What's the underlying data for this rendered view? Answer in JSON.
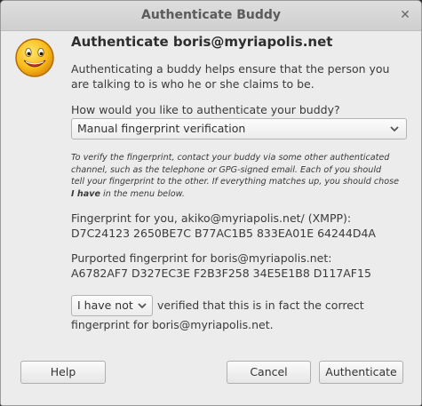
{
  "window": {
    "title": "Authenticate Buddy",
    "close_label": "✕"
  },
  "dialog": {
    "icon": "smiley-icon",
    "heading": "Authenticate boris@myriapolis.net",
    "intro_line1": "Authenticating a buddy helps ensure that the person you",
    "intro_line2": "are talking to is who he or she claims to be.",
    "question": "How would you like to authenticate your buddy?",
    "method_selected": "Manual fingerprint verification",
    "help_line1": "To verify the fingerprint, contact your buddy via some other authenticated",
    "help_line2": "channel, such as the telephone or GPG-signed email.  Each of you should",
    "help_line3_pre": "tell your fingerprint to the other. If everything matches up, you should chose",
    "help_line4_bold": "I have",
    "help_line4_post": " in the menu below.",
    "fp_you_label": "Fingerprint for you, akiko@myriapolis.net/ (XMPP):",
    "fp_you_value": "D7C24123 2650BE7C B77AC1B5 833EA01E 64244D4A",
    "fp_buddy_label": "Purported fingerprint for boris@myriapolis.net:",
    "fp_buddy_value": "A6782AF7 D327EC3E F2B3F258 34E5E1B8 D117AF15",
    "verify_selected": "I have not",
    "verify_rest": "verified that this is in fact the correct",
    "verify_line2": "fingerprint for boris@myriapolis.net."
  },
  "buttons": {
    "help": "Help",
    "cancel": "Cancel",
    "authenticate": "Authenticate"
  },
  "colors": {
    "window_bg": "#ececec",
    "titlebar": "#d6d6d6",
    "smiley_fill": "#f7c21c",
    "smiley_outline": "#c87a0a"
  }
}
